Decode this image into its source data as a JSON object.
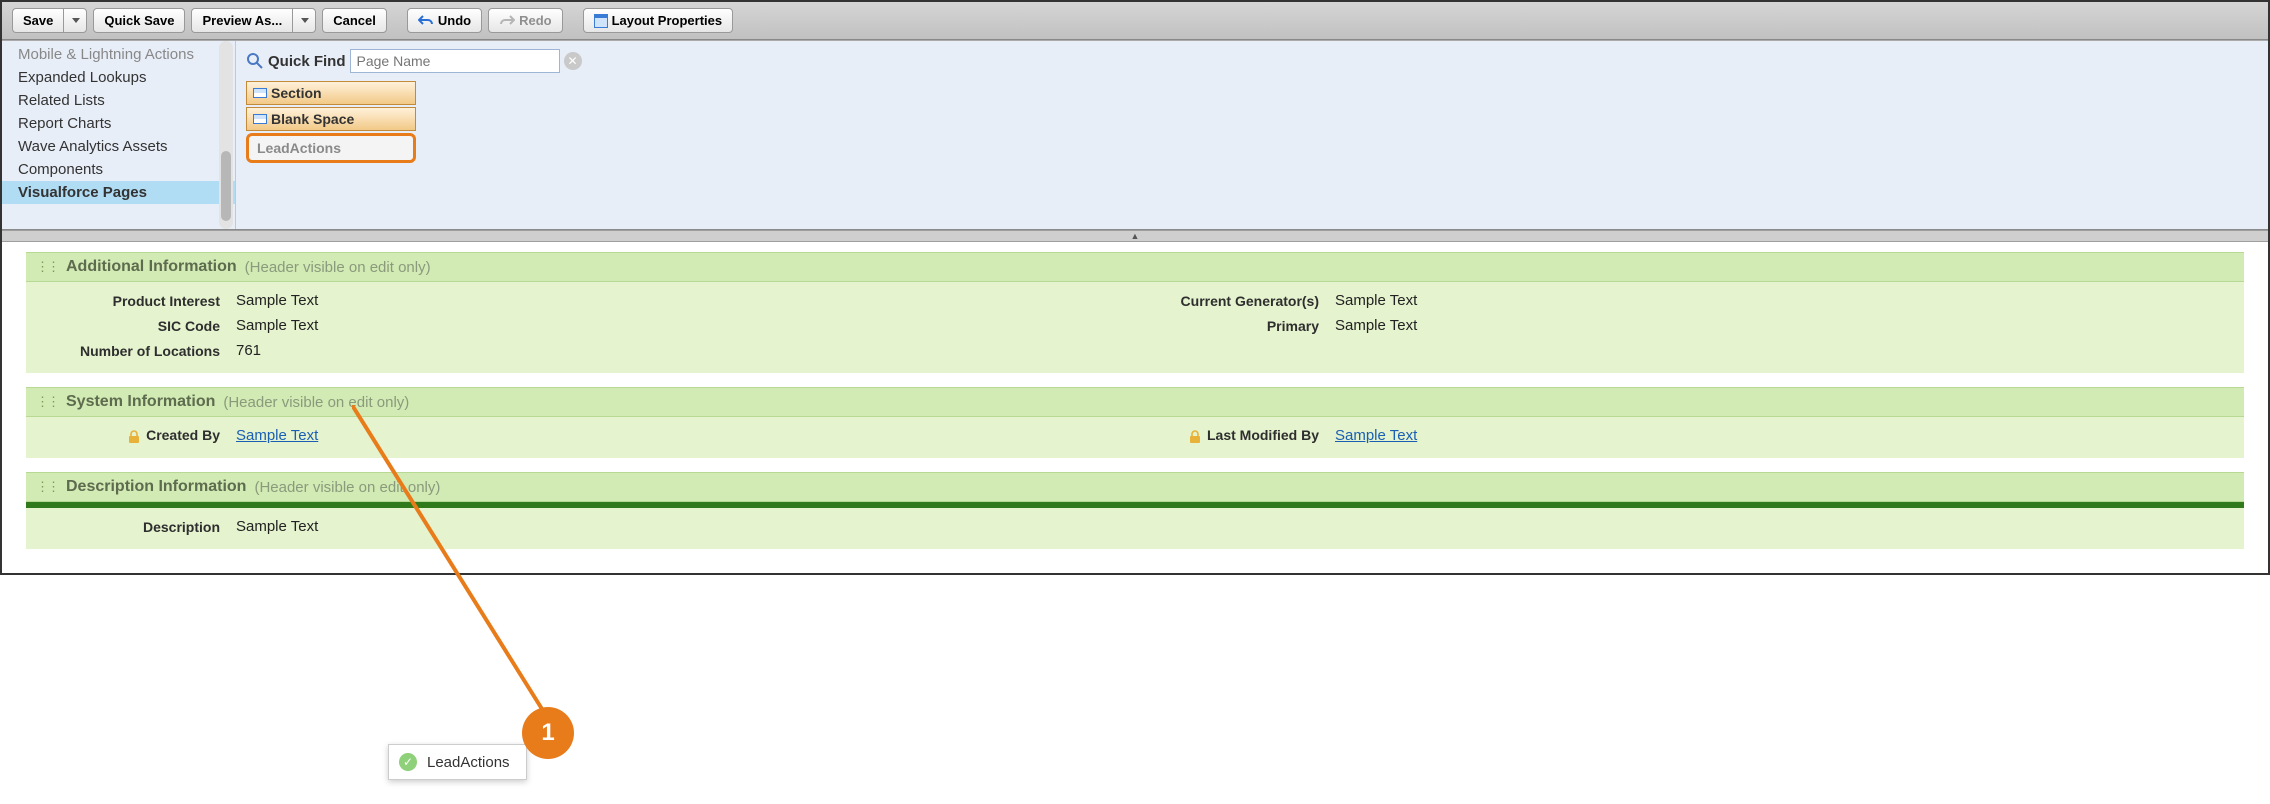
{
  "toolbar": {
    "save": "Save",
    "quick_save": "Quick Save",
    "preview_as": "Preview As...",
    "cancel": "Cancel",
    "undo": "Undo",
    "redo": "Redo",
    "layout_properties": "Layout Properties"
  },
  "sidebar": {
    "items": [
      {
        "label": "Mobile & Lightning Actions",
        "cut": true
      },
      {
        "label": "Expanded Lookups"
      },
      {
        "label": "Related Lists"
      },
      {
        "label": "Report Charts"
      },
      {
        "label": "Wave Analytics Assets"
      },
      {
        "label": "Components"
      },
      {
        "label": "Visualforce Pages",
        "selected": true
      }
    ]
  },
  "quickfind": {
    "label": "Quick Find",
    "placeholder": "Page Name"
  },
  "palette": {
    "items": [
      {
        "label": "Section",
        "type": "section"
      },
      {
        "label": "Blank Space",
        "type": "blank"
      },
      {
        "label": "LeadActions",
        "ghost": true
      }
    ]
  },
  "sections": [
    {
      "title": "Additional Information",
      "hint": "(Header visible on edit only)",
      "left": [
        {
          "label": "Product Interest",
          "value": "Sample Text"
        },
        {
          "label": "SIC Code",
          "value": "Sample Text"
        },
        {
          "label": "Number of Locations",
          "value": "761"
        }
      ],
      "right": [
        {
          "label": "Current Generator(s)",
          "value": "Sample Text"
        },
        {
          "label": "Primary",
          "value": "Sample Text"
        }
      ]
    },
    {
      "title": "System Information",
      "hint": "(Header visible on edit only)",
      "left": [
        {
          "label": "Created By",
          "value": "Sample Text",
          "lock": true,
          "link": true
        }
      ],
      "right": [
        {
          "label": "Last Modified By",
          "value": "Sample Text",
          "lock": true,
          "link": true
        }
      ]
    },
    {
      "title": "Description Information",
      "hint": "(Header visible on edit only)",
      "drop_target": true,
      "left": [
        {
          "label": "Description",
          "value": "Sample Text"
        }
      ],
      "right": []
    }
  ],
  "drop_chip": {
    "label": "LeadActions"
  },
  "annotation": {
    "number": "1"
  }
}
